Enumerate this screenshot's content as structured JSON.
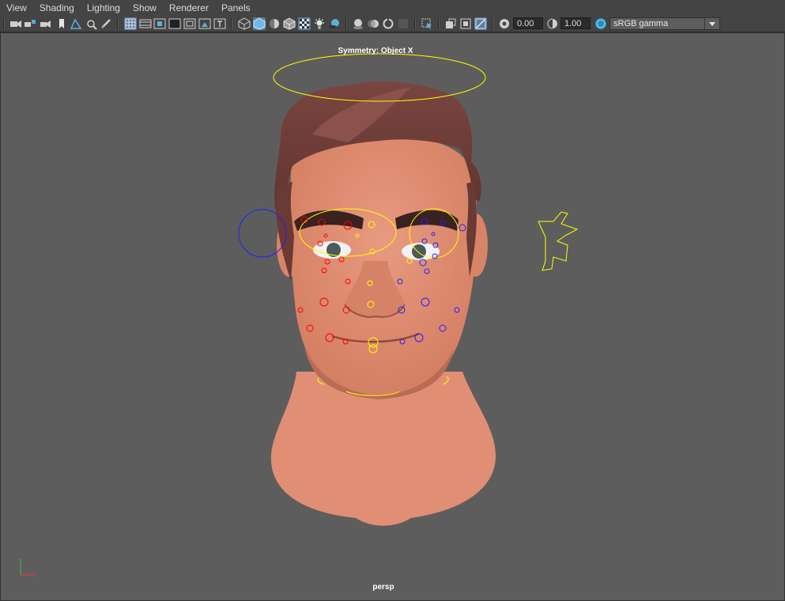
{
  "menu": [
    "View",
    "Shading",
    "Lighting",
    "Show",
    "Renderer",
    "Panels"
  ],
  "toolbar": {
    "exposure_value": "0.00",
    "gamma_value": "1.00",
    "color_space": "sRGB gamma"
  },
  "viewport": {
    "symmetry_label": "Symmetry: Object X",
    "camera_label": "persp"
  },
  "colors": {
    "background": "#5d5d5d",
    "skin": "#e08f74",
    "hair": "#6e3c36",
    "control_left": "#ff0000",
    "control_right": "#2020ff",
    "control_center": "#ffff00"
  }
}
